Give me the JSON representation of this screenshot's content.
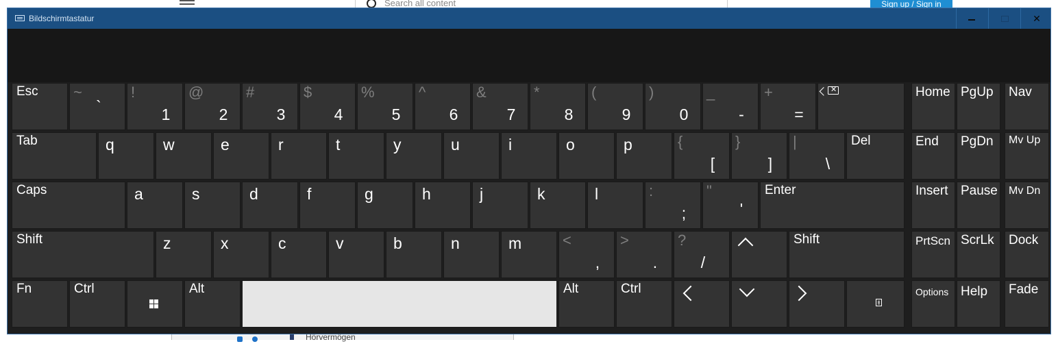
{
  "background_page": {
    "search_placeholder": "Search all content",
    "signup_label": "Sign up / Sign in",
    "bottom_text": "Hörvermögen"
  },
  "window": {
    "title": "Bildschirmtastatur",
    "close_glyph": "✕"
  },
  "keys": {
    "esc": "Esc",
    "tab": "Tab",
    "caps": "Caps",
    "shift_left": "Shift",
    "shift_right": "Shift",
    "fn": "Fn",
    "ctrl_left": "Ctrl",
    "ctrl_right": "Ctrl",
    "alt_left": "Alt",
    "alt_right": "Alt",
    "del": "Del",
    "enter": "Enter",
    "row1": [
      {
        "sec": "~",
        "pri": "`"
      },
      {
        "sec": "!",
        "pri": "1"
      },
      {
        "sec": "@",
        "pri": "2"
      },
      {
        "sec": "#",
        "pri": "3"
      },
      {
        "sec": "$",
        "pri": "4"
      },
      {
        "sec": "%",
        "pri": "5"
      },
      {
        "sec": "^",
        "pri": "6"
      },
      {
        "sec": "&",
        "pri": "7"
      },
      {
        "sec": "*",
        "pri": "8"
      },
      {
        "sec": "(",
        "pri": "9"
      },
      {
        "sec": ")",
        "pri": "0"
      },
      {
        "sec": "_",
        "pri": "-"
      },
      {
        "sec": "+",
        "pri": "="
      }
    ],
    "row2": [
      "q",
      "w",
      "e",
      "r",
      "t",
      "y",
      "u",
      "i",
      "o",
      "p"
    ],
    "row2_sym": [
      {
        "sec": "{",
        "pri": "["
      },
      {
        "sec": "}",
        "pri": "]"
      },
      {
        "sec": "|",
        "pri": "\\"
      }
    ],
    "row3": [
      "a",
      "s",
      "d",
      "f",
      "g",
      "h",
      "j",
      "k",
      "l"
    ],
    "row3_sym": [
      {
        "sec": ":",
        "pri": ";"
      },
      {
        "sec": "\"",
        "pri": "'"
      }
    ],
    "row4": [
      "z",
      "x",
      "c",
      "v",
      "b",
      "n",
      "m"
    ],
    "row4_sym": [
      {
        "sec": "<",
        "pri": ","
      },
      {
        "sec": ">",
        "pri": "."
      },
      {
        "sec": "?",
        "pri": "/"
      }
    ],
    "nav": {
      "home": "Home",
      "pgup": "PgUp",
      "nav": "Nav",
      "end": "End",
      "pgdn": "PgDn",
      "mvup": "Mv Up",
      "insert": "Insert",
      "pause": "Pause",
      "mvdn": "Mv Dn",
      "prtscn": "PrtScn",
      "scrlk": "ScrLk",
      "dock": "Dock",
      "options": "Options",
      "help": "Help",
      "fade": "Fade"
    }
  }
}
